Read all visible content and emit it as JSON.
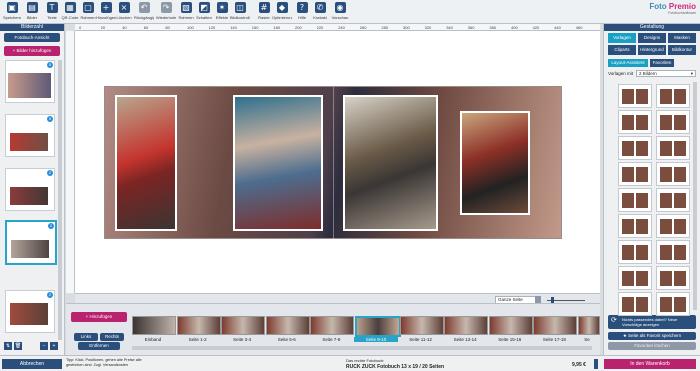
{
  "toolbar": {
    "items": [
      {
        "label": "Speichern",
        "icon": "save-icon"
      },
      {
        "label": "Bilder",
        "icon": "image-icon"
      },
      {
        "label": "Texte",
        "icon": "text-icon"
      },
      {
        "label": "QR-Code",
        "icon": "qr-code-icon"
      },
      {
        "label": "Rahmen",
        "icon": "frame-icon"
      },
      {
        "label": "Hinzufügen",
        "icon": "add-page-icon"
      },
      {
        "label": "Löschen",
        "icon": "delete-page-icon"
      },
      {
        "label": "Rückgängig",
        "icon": "undo-icon"
      },
      {
        "label": "Wiederholen",
        "icon": "redo-icon"
      },
      {
        "label": "Rahmen",
        "icon": "frame-style-icon"
      },
      {
        "label": "Schatten",
        "icon": "shadow-icon"
      },
      {
        "label": "Effekte",
        "icon": "effects-icon"
      },
      {
        "label": "Bildkontrolle",
        "icon": "image-check-icon"
      },
      {
        "label": "Raster",
        "icon": "grid-icon"
      },
      {
        "label": "Optimierung",
        "icon": "optimize-icon"
      },
      {
        "label": "Hilfe",
        "icon": "help-icon"
      },
      {
        "label": "Kontakt",
        "icon": "phone-icon"
      },
      {
        "label": "Vorschau",
        "icon": "preview-icon"
      }
    ],
    "logo": {
      "brand_a": "Foto",
      "brand_b": "Premio",
      "tagline": "Fotobuchsoftware"
    }
  },
  "left_panel": {
    "header": "Bilderzahl",
    "view_button": "Fotobuch-Ansicht",
    "add_images_button": "Bilder hinzufügen",
    "thumb_badges": [
      "5",
      "5",
      "2",
      "2",
      "2"
    ],
    "back_button": "Abbrechen"
  },
  "ruler": {
    "top_ticks": [
      "0",
      "20",
      "40",
      "60",
      "80",
      "100",
      "120",
      "140",
      "160",
      "180",
      "200",
      "220",
      "240",
      "260",
      "280",
      "300",
      "320",
      "340",
      "360",
      "380",
      "400",
      "420",
      "440",
      "460"
    ]
  },
  "view_controls": {
    "zoom_select": "Ganze Seite"
  },
  "filmstrip": {
    "add_button": "Hinzufügen",
    "left_button": "Links",
    "right_button": "Rechts",
    "remove_button": "Entfernen",
    "pages": [
      "Einband",
      "Seite 1-2",
      "Seite 3-4",
      "Seite 5-6",
      "Seite 7-8",
      "Seite 9-10",
      "Seite 11-12",
      "Seite 13-14",
      "Seite 15-16",
      "Seite 17-18",
      "Se"
    ],
    "selected_index": 5
  },
  "right_panel": {
    "header": "Gestaltung",
    "tabs_row1": [
      "Vorlagen",
      "Designs",
      "Masken"
    ],
    "tabs_row2": [
      "Cliparts",
      "Hintergrund",
      "Bildkontur"
    ],
    "subtabs": [
      "Layout-Assistent",
      "Favoriten"
    ],
    "filter_label": "Vorlagen mit",
    "filter_value": "2 Bildern",
    "suggest_button": "Nichts passendes dabei? Neue Vorschläge anzeigen",
    "favorite_button": "Seite als Favorit speichern",
    "favorites_link": "Favoriten löschen"
  },
  "status": {
    "info_text": "Tipp: Klick, Positionen, gehen alle Preise alle gestrichen sind. Zzgl. Versandkosten",
    "product_label": "Das rechte Fotobuch:",
    "product_name": "RUCK ZUCK Fotobuch 13 x 19 / 20 Seiten",
    "price": "9,95 €",
    "cart_button": "In den Warenkorb"
  },
  "colors": {
    "accent": "#29a3c8",
    "brand": "#2b4f7c",
    "pink": "#b8226e"
  }
}
